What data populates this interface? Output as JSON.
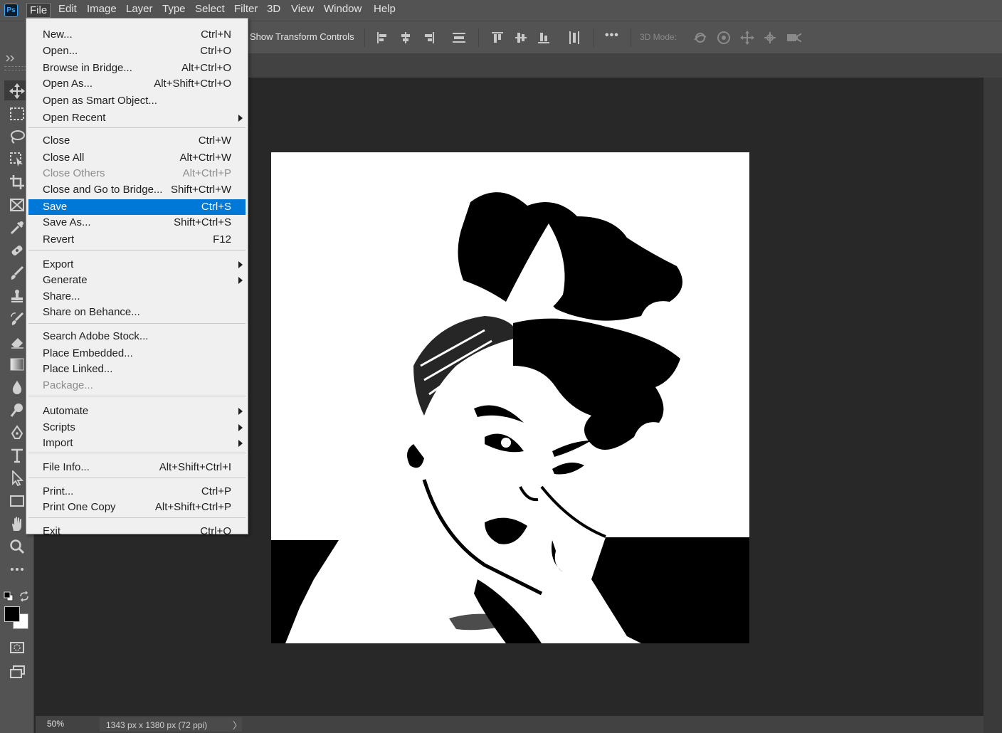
{
  "app": {
    "logo_text": "Ps"
  },
  "menubar": {
    "items": [
      "File",
      "Edit",
      "Image",
      "Layer",
      "Type",
      "Select",
      "Filter",
      "3D",
      "View",
      "Window",
      "Help"
    ],
    "active": "File"
  },
  "options_bar": {
    "show_transform_controls": "Show Transform Controls",
    "more_label": "•••",
    "mode_3d_label": "3D Mode:"
  },
  "file_menu": {
    "groups": [
      [
        {
          "label": "New...",
          "shortcut": "Ctrl+N"
        },
        {
          "label": "Open...",
          "shortcut": "Ctrl+O"
        },
        {
          "label": "Browse in Bridge...",
          "shortcut": "Alt+Ctrl+O"
        },
        {
          "label": "Open As...",
          "shortcut": "Alt+Shift+Ctrl+O"
        },
        {
          "label": "Open as Smart Object...",
          "shortcut": ""
        },
        {
          "label": "Open Recent",
          "shortcut": "",
          "submenu": true
        }
      ],
      [
        {
          "label": "Close",
          "shortcut": "Ctrl+W"
        },
        {
          "label": "Close All",
          "shortcut": "Alt+Ctrl+W"
        },
        {
          "label": "Close Others",
          "shortcut": "Alt+Ctrl+P",
          "disabled": true
        },
        {
          "label": "Close and Go to Bridge...",
          "shortcut": "Shift+Ctrl+W"
        },
        {
          "label": "Save",
          "shortcut": "Ctrl+S",
          "highlighted": true
        },
        {
          "label": "Save As...",
          "shortcut": "Shift+Ctrl+S"
        },
        {
          "label": "Revert",
          "shortcut": "F12"
        }
      ],
      [
        {
          "label": "Export",
          "shortcut": "",
          "submenu": true
        },
        {
          "label": "Generate",
          "shortcut": "",
          "submenu": true
        },
        {
          "label": "Share...",
          "shortcut": ""
        },
        {
          "label": "Share on Behance...",
          "shortcut": ""
        }
      ],
      [
        {
          "label": "Search Adobe Stock...",
          "shortcut": ""
        },
        {
          "label": "Place Embedded...",
          "shortcut": ""
        },
        {
          "label": "Place Linked...",
          "shortcut": ""
        },
        {
          "label": "Package...",
          "shortcut": "",
          "disabled": true
        }
      ],
      [
        {
          "label": "Automate",
          "shortcut": "",
          "submenu": true
        },
        {
          "label": "Scripts",
          "shortcut": "",
          "submenu": true
        },
        {
          "label": "Import",
          "shortcut": "",
          "submenu": true
        }
      ],
      [
        {
          "label": "File Info...",
          "shortcut": "Alt+Shift+Ctrl+I"
        }
      ],
      [
        {
          "label": "Print...",
          "shortcut": "Ctrl+P"
        },
        {
          "label": "Print One Copy",
          "shortcut": "Alt+Shift+Ctrl+P"
        }
      ],
      [
        {
          "label": "Exit",
          "shortcut": "Ctrl+Q"
        }
      ]
    ]
  },
  "tools": [
    "move-tool",
    "marquee-tool",
    "lasso-tool",
    "object-select-tool",
    "crop-tool",
    "frame-tool",
    "eyedropper-tool",
    "healing-brush-tool",
    "brush-tool",
    "clone-stamp-tool",
    "history-brush-tool",
    "eraser-tool",
    "gradient-tool",
    "blur-tool",
    "dodge-tool",
    "pen-tool",
    "type-tool",
    "path-select-tool",
    "rectangle-tool",
    "hand-tool",
    "zoom-tool",
    "edit-toolbar"
  ],
  "colors": {
    "foreground": "#000000",
    "background": "#ffffff",
    "highlight": "#0078d7"
  },
  "status": {
    "zoom": "50%",
    "doc_info": "1343 px x 1380 px (72 ppi)",
    "arrow": "〉"
  }
}
